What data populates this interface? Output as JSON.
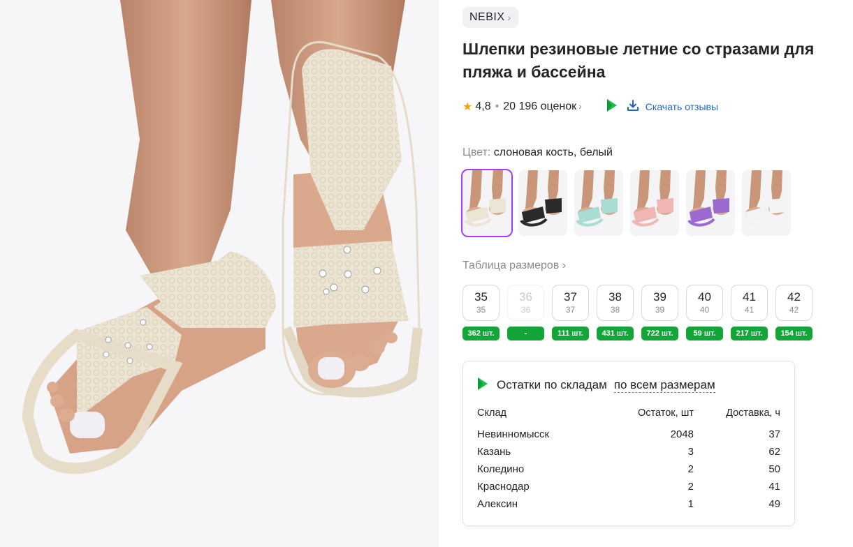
{
  "brand": {
    "name": "NEBIX",
    "chevron": "›"
  },
  "product": {
    "title": "Шлепки резиновые летние со стразами для пляжа и бассейна"
  },
  "rating": {
    "star": "★",
    "value": "4,8",
    "separator": "•",
    "reviews": "20 196 оценок",
    "chevron": "›",
    "download_label": "Скачать отзывы"
  },
  "color": {
    "label": "Цвет:",
    "value": "слоновая кость, белый"
  },
  "thumbnails": [
    {
      "name": "ivory",
      "strap": "#ece4d4",
      "selected": true
    },
    {
      "name": "black",
      "strap": "#2a2a2a",
      "selected": false
    },
    {
      "name": "mint",
      "strap": "#a9dcd2",
      "selected": false
    },
    {
      "name": "pink",
      "strap": "#efb6b4",
      "selected": false
    },
    {
      "name": "purple",
      "strap": "#9b6ad1",
      "selected": false
    },
    {
      "name": "white",
      "strap": "#f3f3f3",
      "selected": false
    }
  ],
  "size_table": {
    "label": "Таблица размеров",
    "chevron": "›"
  },
  "sizes": [
    {
      "main": "35",
      "sub": "35",
      "stock": "362 шт.",
      "disabled": false
    },
    {
      "main": "36",
      "sub": "36",
      "stock": "-",
      "disabled": true
    },
    {
      "main": "37",
      "sub": "37",
      "stock": "111 шт.",
      "disabled": false
    },
    {
      "main": "38",
      "sub": "38",
      "stock": "431 шт.",
      "disabled": false
    },
    {
      "main": "39",
      "sub": "39",
      "stock": "722 шт.",
      "disabled": false
    },
    {
      "main": "40",
      "sub": "40",
      "stock": "59 шт.",
      "disabled": false
    },
    {
      "main": "41",
      "sub": "41",
      "stock": "217 шт.",
      "disabled": false
    },
    {
      "main": "42",
      "sub": "42",
      "stock": "154 шт.",
      "disabled": false
    }
  ],
  "warehouses": {
    "title": "Остатки по складам",
    "filter": "по всем размерам",
    "columns": [
      "Склад",
      "Остаток, шт",
      "Доставка, ч"
    ],
    "rows": [
      [
        "Невинномысск",
        "2048",
        "37"
      ],
      [
        "Казань",
        "3",
        "62"
      ],
      [
        "Коледино",
        "2",
        "50"
      ],
      [
        "Краснодар",
        "2",
        "41"
      ],
      [
        "Алексин",
        "1",
        "49"
      ]
    ]
  },
  "colors": {
    "accent": "#a73afd",
    "stock_green": "#13a538",
    "link_blue": "#2364c8",
    "star": "#ff9d00"
  }
}
